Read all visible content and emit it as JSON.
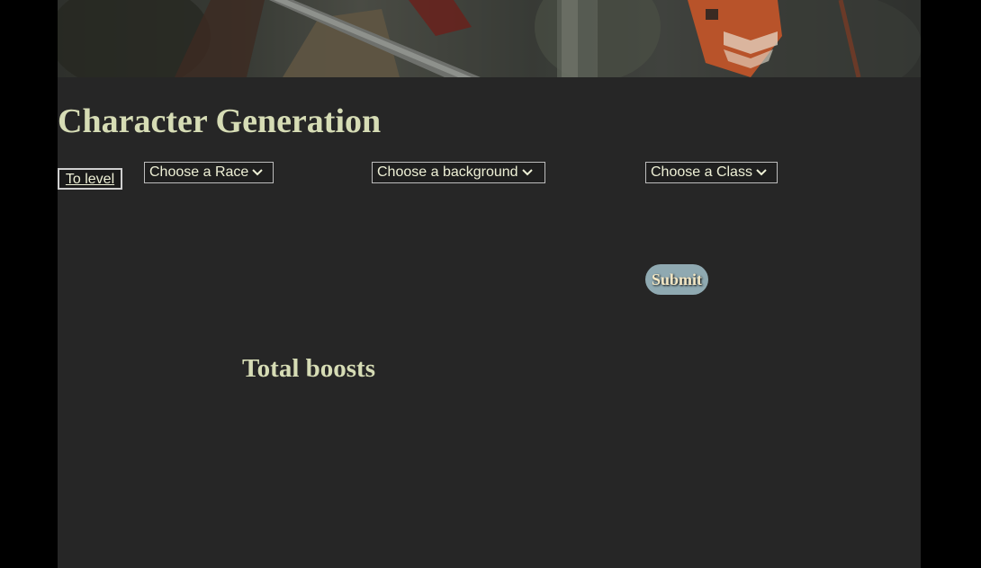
{
  "header": {
    "title": "Character Generation"
  },
  "controls": {
    "to_level_label": "To level",
    "race_select": "Choose a Race",
    "background_select": "Choose a background",
    "class_select": "Choose a Class",
    "submit_label": "Submit"
  },
  "boosts": {
    "title": "Total boosts"
  },
  "colors": {
    "page_background": "#262626",
    "outer_background": "#000000",
    "heading_text": "#d6dcb5",
    "submit_background": "#8fa9b1"
  }
}
